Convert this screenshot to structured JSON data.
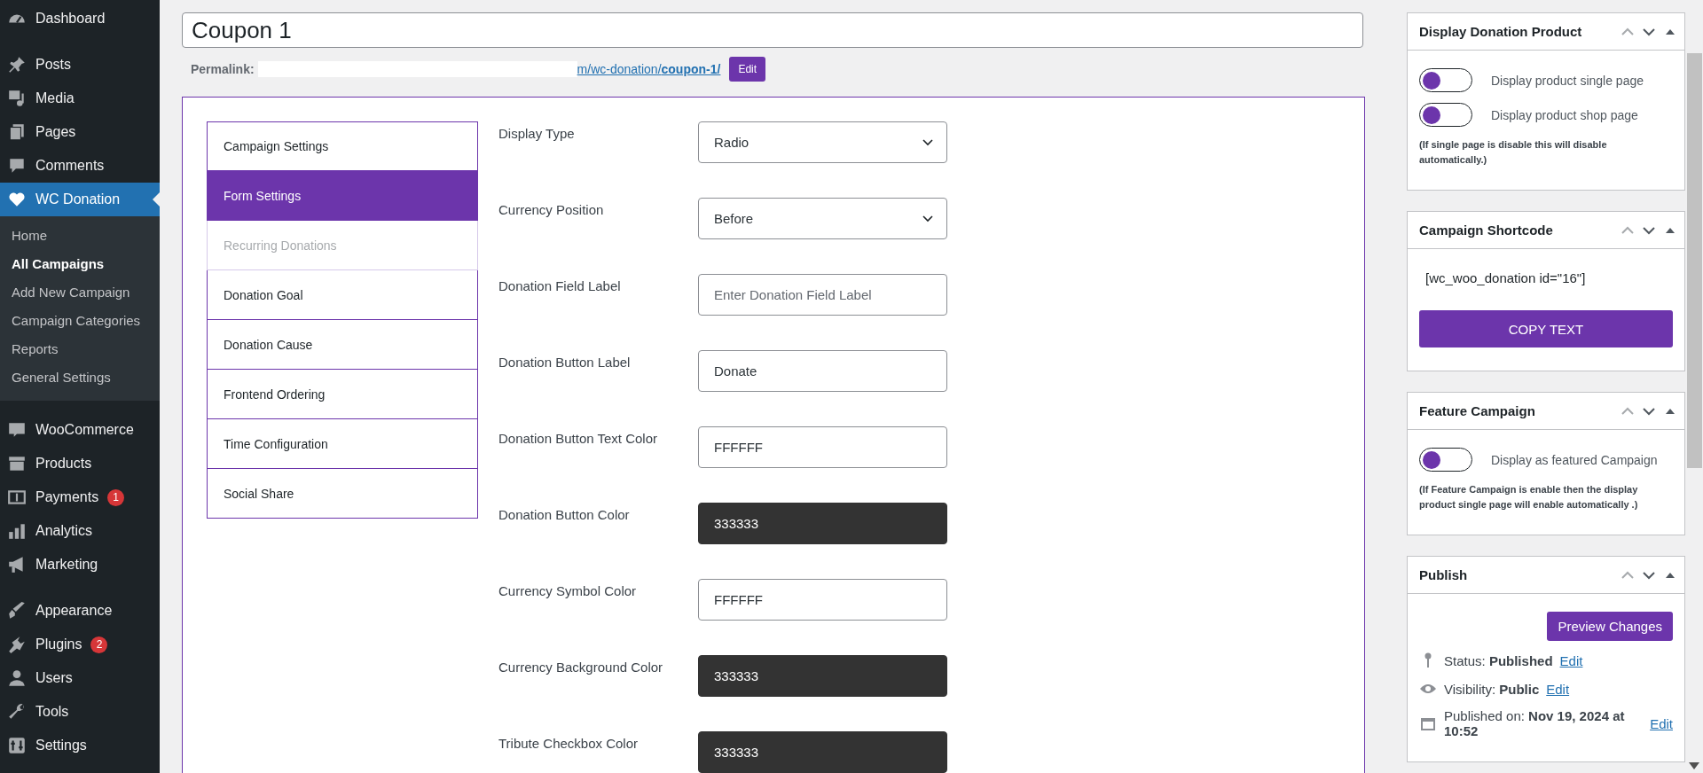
{
  "sidebar": {
    "groups": [
      {
        "items": [
          {
            "label": "Dashboard",
            "selected": false
          }
        ]
      },
      {
        "items": [
          {
            "label": "Posts",
            "selected": false
          },
          {
            "label": "Media",
            "selected": false
          },
          {
            "label": "Pages",
            "selected": false
          },
          {
            "label": "Comments",
            "selected": false
          },
          {
            "label": "WC Donation",
            "selected": true,
            "submenu": [
              {
                "label": "Home",
                "selected": false
              },
              {
                "label": "All Campaigns",
                "selected": true
              },
              {
                "label": "Add New Campaign",
                "selected": false
              },
              {
                "label": "Campaign Categories",
                "selected": false
              },
              {
                "label": "Reports",
                "selected": false
              },
              {
                "label": "General Settings",
                "selected": false
              }
            ]
          }
        ]
      },
      {
        "items": [
          {
            "label": "WooCommerce",
            "selected": false
          },
          {
            "label": "Products",
            "selected": false
          },
          {
            "label": "Payments",
            "selected": false,
            "badge": "1"
          },
          {
            "label": "Analytics",
            "selected": false
          },
          {
            "label": "Marketing",
            "selected": false
          }
        ]
      },
      {
        "items": [
          {
            "label": "Appearance",
            "selected": false
          },
          {
            "label": "Plugins",
            "selected": false,
            "badge": "2"
          },
          {
            "label": "Users",
            "selected": false
          },
          {
            "label": "Tools",
            "selected": false
          },
          {
            "label": "Settings",
            "selected": false
          }
        ]
      }
    ]
  },
  "title_field": {
    "value": "Coupon 1"
  },
  "permalink": {
    "label": "Permalink:",
    "url": "m/wc-donation/**coupon-1/**",
    "edit_button": "Edit"
  },
  "settings_tabs": [
    {
      "label": "Campaign Settings",
      "selected": false,
      "disabled": false
    },
    {
      "label": "Form Settings",
      "selected": true,
      "disabled": false
    },
    {
      "label": "Recurring Donations",
      "selected": false,
      "disabled": true
    },
    {
      "label": "Donation Goal",
      "selected": false,
      "disabled": false
    },
    {
      "label": "Donation Cause",
      "selected": false,
      "disabled": false
    },
    {
      "label": "Frontend Ordering",
      "selected": false,
      "disabled": false
    },
    {
      "label": "Time Configuration",
      "selected": false,
      "disabled": false
    },
    {
      "label": "Social Share",
      "selected": false,
      "disabled": false
    }
  ],
  "form_fields": [
    {
      "label": "Display Type",
      "kind": "select",
      "value": "Radio"
    },
    {
      "label": "Currency Position",
      "kind": "select",
      "value": "Before"
    },
    {
      "label": "Donation Field Label",
      "kind": "text",
      "placeholder": "Enter Donation Field Label"
    },
    {
      "label": "Donation Button Label",
      "kind": "text",
      "value": "Donate"
    },
    {
      "label": "Donation Button Text Color",
      "kind": "color",
      "value": "FFFFFF"
    },
    {
      "label": "Donation Button Color",
      "kind": "color",
      "value": "333333"
    },
    {
      "label": "Currency Symbol Color",
      "kind": "color",
      "value": "FFFFFF"
    },
    {
      "label": "Currency Background Color",
      "kind": "color",
      "value": "333333"
    },
    {
      "label": "Tribute Checkbox Color",
      "kind": "color",
      "value": "333333"
    }
  ],
  "panels": [
    {
      "title": "Display Donation Product",
      "kind": "toggles",
      "toggles": [
        {
          "label": "Display product single page",
          "on": false
        },
        {
          "label": "Display product shop page",
          "on": false
        }
      ],
      "note": "(If single page is disable this will disable automatically.)"
    },
    {
      "title": "Campaign Shortcode",
      "kind": "shortcode",
      "code": "[wc_woo_donation id=\"16\"]",
      "button": "COPY TEXT"
    },
    {
      "title": "Feature Campaign",
      "kind": "toggles",
      "toggles": [
        {
          "label": "Display as featured Campaign",
          "on": false
        }
      ],
      "note": "(If Feature Campaign is enable then the display product single page will enable automatically .)"
    },
    {
      "title": "Publish",
      "kind": "publish",
      "button": "Preview Changes",
      "rows": [
        {
          "kind": "status",
          "label": "Status:",
          "value": "Published",
          "link": "Edit"
        },
        {
          "kind": "visibility",
          "label": "Visibility:",
          "value": "Public",
          "link": "Edit"
        },
        {
          "kind": "date",
          "label": "Published on:",
          "value": "Nov 19, 2024 at 10:52",
          "link": "Edit"
        }
      ]
    }
  ]
}
